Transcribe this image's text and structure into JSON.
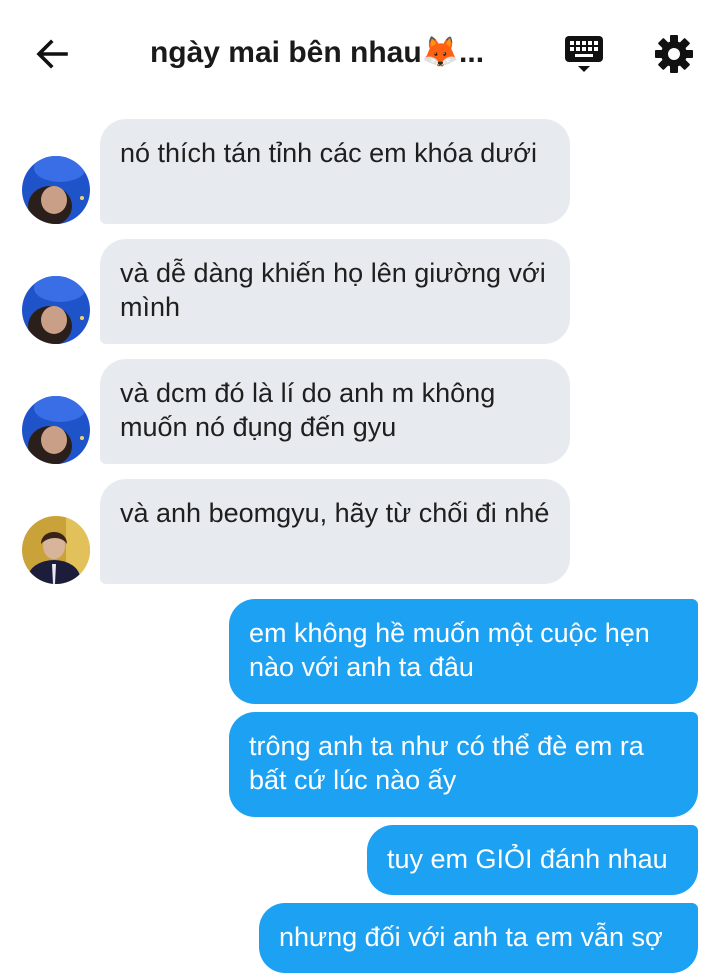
{
  "header": {
    "title": "ngày mai bên nhau🦊...",
    "back_icon": "arrow-left-icon",
    "keyboard_icon": "keyboard-icon",
    "settings_icon": "gear-icon"
  },
  "messages": [
    {
      "direction": "incoming",
      "avatar": "blue-night-avatar",
      "text": "nó thích tán tỉnh các em khóa dưới"
    },
    {
      "direction": "incoming",
      "avatar": "blue-night-avatar",
      "text": "và dễ dàng khiến họ lên giường với mình"
    },
    {
      "direction": "incoming",
      "avatar": "blue-night-avatar",
      "text": "và dcm đó là lí do anh m không muốn nó đụng đến gyu"
    },
    {
      "direction": "incoming",
      "avatar": "suit-portrait-avatar",
      "text": "và anh beomgyu, hãy từ chối đi nhé"
    },
    {
      "direction": "outgoing",
      "text": "em không hề muốn một cuộc hẹn nào với anh ta đâu"
    },
    {
      "direction": "outgoing",
      "text": "trông anh ta như có thể đè em ra bất cứ lúc nào ấy"
    },
    {
      "direction": "outgoing",
      "text": "tuy em GIỎI đánh nhau"
    },
    {
      "direction": "outgoing",
      "text": "nhưng đối với anh ta em vẫn sợ"
    }
  ],
  "colors": {
    "incoming_bubble": "#e7ebef",
    "outgoing_bubble": "#1da1f2",
    "outgoing_text": "#ffffff"
  }
}
